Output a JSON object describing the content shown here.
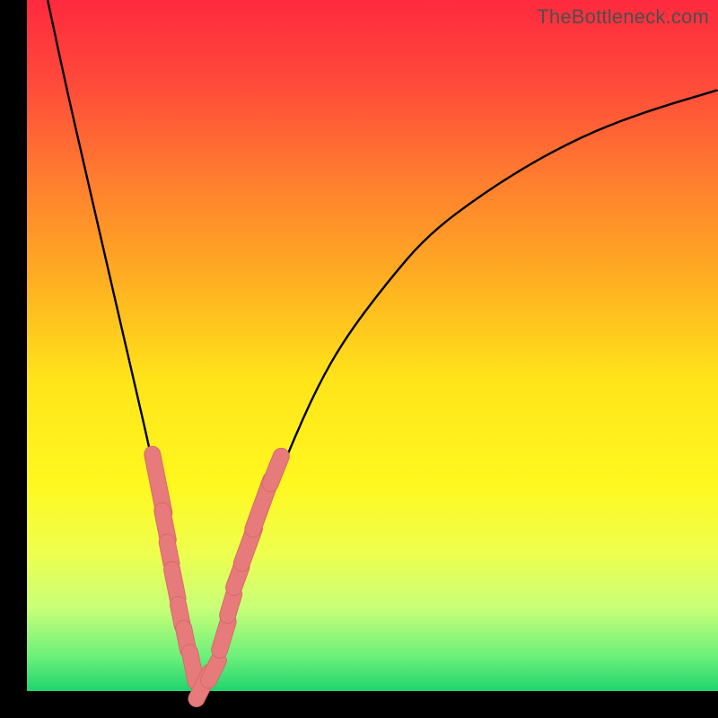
{
  "watermark": "TheBottleneck.com",
  "colors": {
    "frame": "#000000",
    "curve": "#000000",
    "marker_fill": "#e77a7a",
    "marker_stroke": "#d86a6a"
  },
  "chart_data": {
    "type": "line",
    "title": "",
    "xlabel": "",
    "ylabel": "",
    "xlim": [
      0,
      100
    ],
    "ylim": [
      0,
      100
    ],
    "grid": false,
    "legend": false,
    "series": [
      {
        "name": "bottleneck-curve",
        "x": [
          3,
          6,
          9,
          12,
          15,
          18,
          20,
          22,
          24,
          25,
          27,
          30,
          34,
          38,
          42,
          46,
          52,
          58,
          66,
          74,
          82,
          90,
          100
        ],
        "y": [
          100,
          86,
          73,
          60,
          47,
          34,
          24,
          14,
          4,
          0,
          4,
          14,
          25,
          35,
          44,
          51,
          59,
          66,
          72,
          77,
          81,
          84,
          87
        ]
      }
    ],
    "markers": [
      {
        "x": 19.0,
        "y": 30.0,
        "len": 5.0
      },
      {
        "x": 20.0,
        "y": 24.0,
        "len": 3.0
      },
      {
        "x": 20.6,
        "y": 20.0,
        "len": 2.5
      },
      {
        "x": 21.4,
        "y": 15.5,
        "len": 3.0
      },
      {
        "x": 22.2,
        "y": 11.0,
        "len": 2.5
      },
      {
        "x": 23.0,
        "y": 7.5,
        "len": 2.5
      },
      {
        "x": 24.0,
        "y": 3.5,
        "len": 3.0
      },
      {
        "x": 25.5,
        "y": 0.8,
        "len": 3.0
      },
      {
        "x": 27.0,
        "y": 3.0,
        "len": 2.5
      },
      {
        "x": 28.5,
        "y": 8.0,
        "len": 3.0
      },
      {
        "x": 29.5,
        "y": 12.5,
        "len": 2.5
      },
      {
        "x": 30.5,
        "y": 16.5,
        "len": 2.5
      },
      {
        "x": 32.0,
        "y": 21.0,
        "len": 3.5
      },
      {
        "x": 34.0,
        "y": 27.0,
        "len": 4.5
      },
      {
        "x": 36.0,
        "y": 32.0,
        "len": 3.0
      }
    ],
    "optimum_x": 25
  }
}
